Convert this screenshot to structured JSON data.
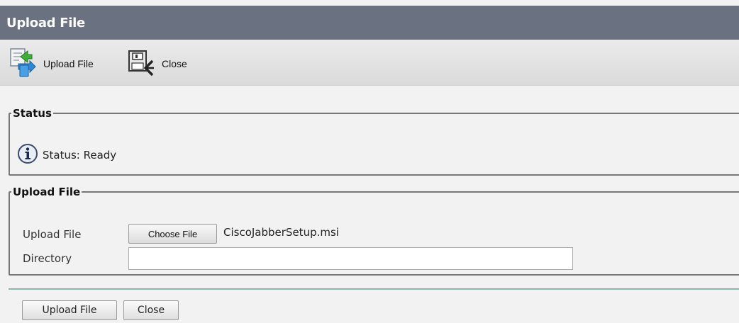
{
  "window": {
    "title": "Upload File"
  },
  "toolbar": {
    "upload": {
      "label": "Upload File",
      "icon": "upload-file-icon"
    },
    "close": {
      "label": "Close",
      "icon": "close-icon"
    }
  },
  "status": {
    "legend": "Status",
    "icon": "info-icon",
    "text": "Status: Ready"
  },
  "upload_section": {
    "legend": "Upload File",
    "file_label": "Upload File",
    "choose_button": "Choose File",
    "chosen_file": "CiscoJabberSetup.msi",
    "directory_label": "Directory",
    "directory_value": ""
  },
  "footer": {
    "upload_button": "Upload File",
    "close_button": "Close"
  },
  "colors": {
    "title_bar": "#6a7181",
    "separator": "#8fb3ad"
  }
}
